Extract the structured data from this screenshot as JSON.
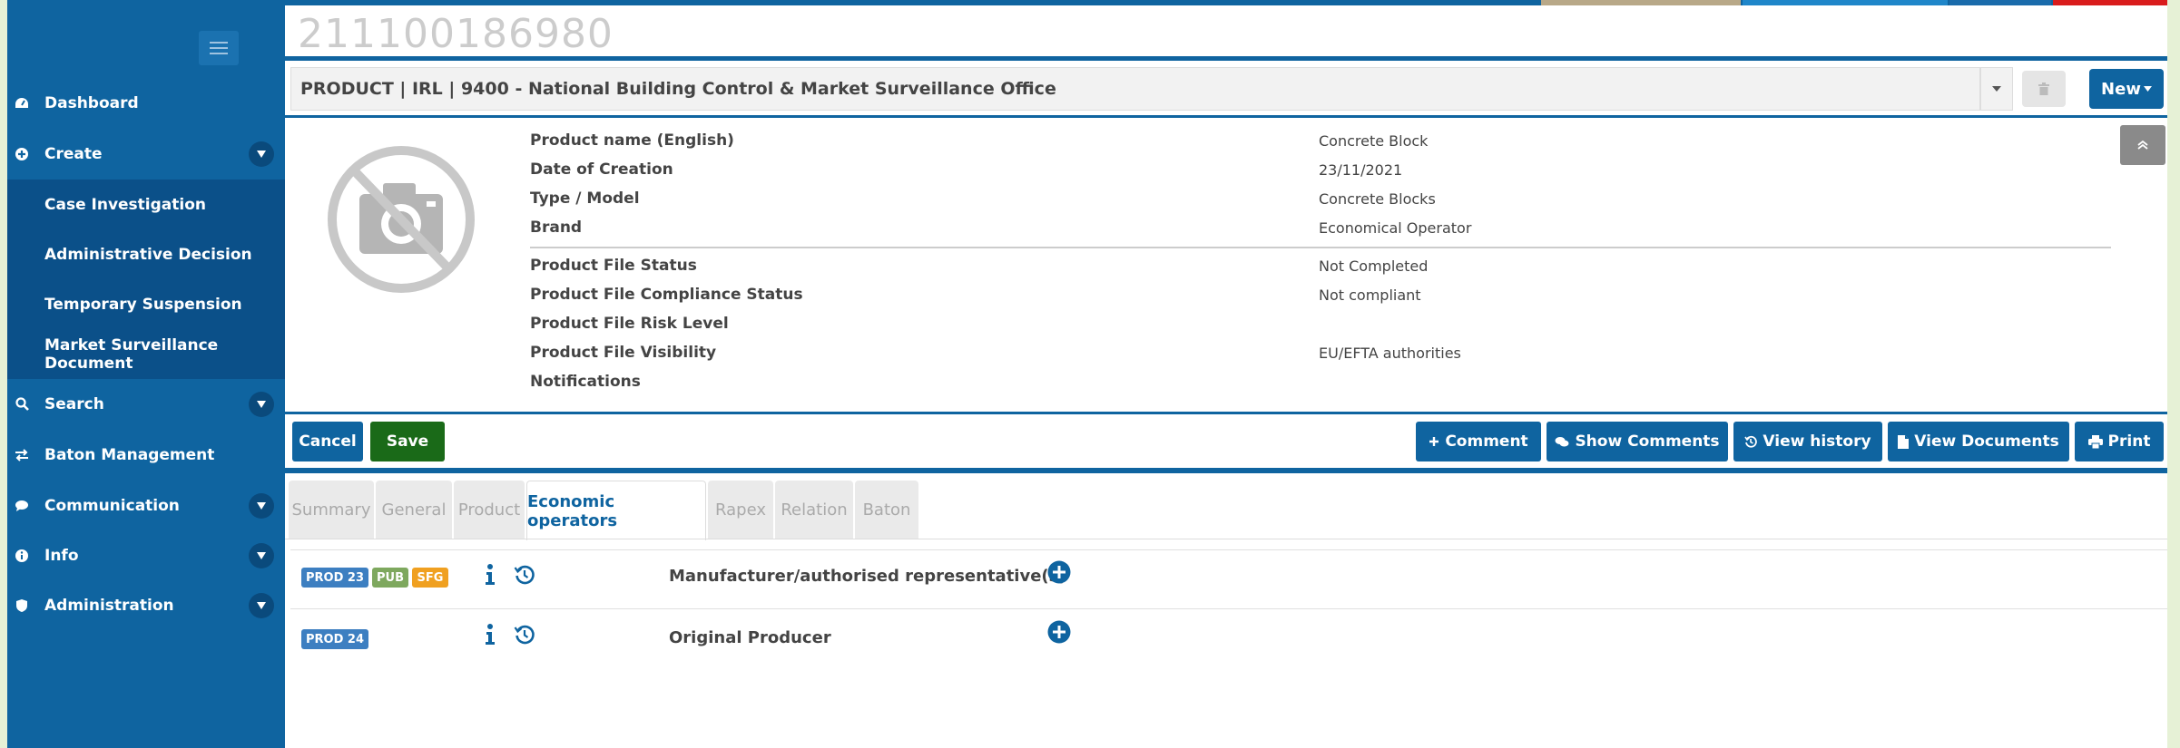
{
  "case_number": "211100186980",
  "sidebar": {
    "items": [
      {
        "label": "Dashboard",
        "icon": "dashboard-icon"
      },
      {
        "label": "Create",
        "icon": "plus-circle-icon",
        "has_caret": true
      },
      {
        "label": "Case Investigation",
        "sub": true
      },
      {
        "label": "Administrative Decision",
        "sub": true
      },
      {
        "label": "Temporary Suspension",
        "sub": true
      },
      {
        "label": "Market Surveillance Document",
        "sub": true
      },
      {
        "label": "Search",
        "icon": "search-icon",
        "has_caret": true
      },
      {
        "label": "Baton Management",
        "icon": "exchange-icon"
      },
      {
        "label": "Communication",
        "icon": "comment-icon",
        "has_caret": true
      },
      {
        "label": "Info",
        "icon": "info-circle-icon",
        "has_caret": true
      },
      {
        "label": "Administration",
        "icon": "shield-icon",
        "has_caret": true
      }
    ]
  },
  "product_bar": {
    "title": "PRODUCT | IRL | 9400 - National Building Control & Market Surveillance Office",
    "new_label": "New"
  },
  "details": {
    "product_name_label": "Product name (English)",
    "product_name_value": "Concrete Block",
    "date_label": "Date of Creation",
    "date_value": "23/11/2021",
    "type_label": "Type / Model",
    "type_value": "Concrete Blocks",
    "brand_label": "Brand",
    "brand_value": "Economical Operator",
    "status_label": "Product File Status",
    "status_value": "Not Completed",
    "compliance_label": "Product File Compliance Status",
    "compliance_value": "Not compliant",
    "risk_label": "Product File Risk Level",
    "risk_value": "",
    "visibility_label": "Product File Visibility",
    "visibility_value": "EU/EFTA authorities",
    "notifications_label": "Notifications"
  },
  "actions": {
    "cancel": "Cancel",
    "save": "Save",
    "comment": "Comment",
    "show_comments": "Show Comments",
    "view_history": "View history",
    "view_documents": "View Documents",
    "print": "Print"
  },
  "tabs": [
    {
      "label": "Summary"
    },
    {
      "label": "General"
    },
    {
      "label": "Product"
    },
    {
      "label": "Economic operators",
      "active": true
    },
    {
      "label": "Rapex"
    },
    {
      "label": "Relation"
    },
    {
      "label": "Baton"
    }
  ],
  "operators": [
    {
      "badges": [
        "PROD 23",
        "PUB",
        "SFG"
      ],
      "title": "Manufacturer/authorised representative(s)"
    },
    {
      "badges": [
        "PROD 24"
      ],
      "title": "Original Producer"
    }
  ],
  "colors": {
    "primary": "#0f64a0",
    "sidebar": "#0f64a0",
    "save_green": "#1a6a18",
    "badge_blue": "#3d7fc1",
    "badge_green": "#7ea85e",
    "badge_orange": "#f0a020"
  }
}
